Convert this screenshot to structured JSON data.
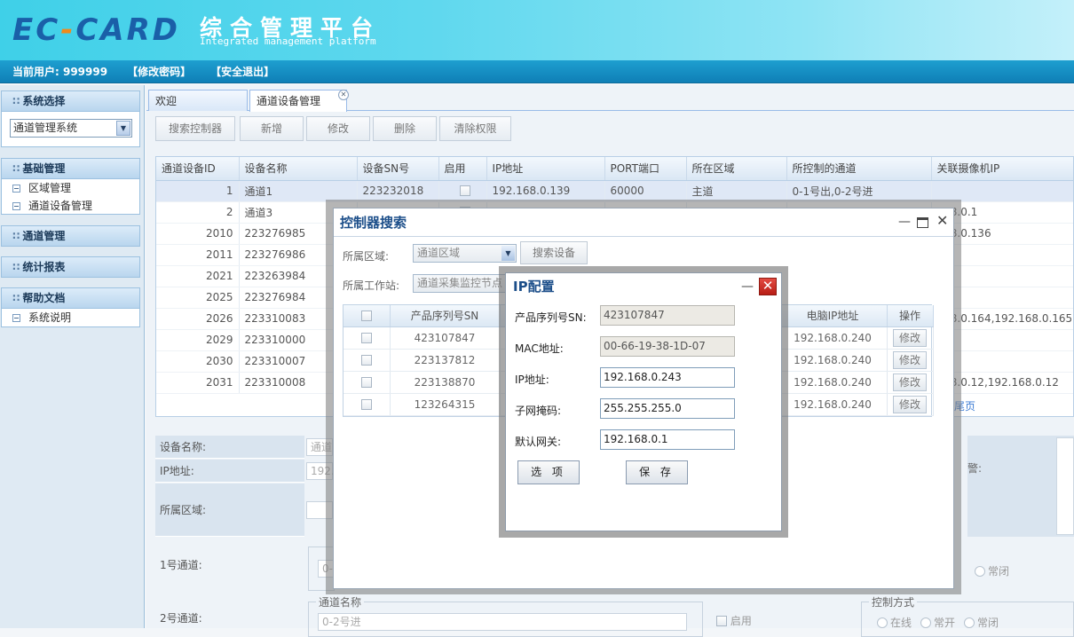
{
  "header": {
    "logo_left": "EC",
    "logo_dash": "-",
    "logo_right": "CARD",
    "title": "综合管理平台",
    "subtitle": "Integrated management platform"
  },
  "userbar": {
    "current_user": "当前用户: 999999",
    "change_pwd": "【修改密码】",
    "logout": "【安全退出】"
  },
  "sidebar": {
    "system_select": {
      "label": "系统选择",
      "value": "通道管理系统"
    },
    "basic": {
      "label": "基础管理",
      "items": [
        "区域管理",
        "通道设备管理"
      ]
    },
    "channel": {
      "label": "通道管理"
    },
    "stats": {
      "label": "统计报表"
    },
    "help": {
      "label": "帮助文档",
      "items": [
        "系统说明"
      ]
    }
  },
  "tabs": [
    "欢迎",
    "通道设备管理"
  ],
  "toolbar": {
    "search": "搜索控制器",
    "add": "新增",
    "edit": "修改",
    "delete": "删除",
    "clear": "清除权限"
  },
  "grid": {
    "columns": [
      "通道设备ID",
      "设备名称",
      "设备SN号",
      "启用",
      "IP地址",
      "PORT端口",
      "所在区域",
      "所控制的通道",
      "关联摄像机IP"
    ],
    "rows": [
      {
        "id": "1",
        "name": "通道1",
        "sn": "223232018",
        "ip": "192.168.0.139",
        "port": "60000",
        "area": "主道",
        "channels": "0-1号出,0-2号进",
        "cam": ""
      },
      {
        "id": "2",
        "name": "通道3",
        "sn": "",
        "ip": "",
        "port": "",
        "area": "",
        "channels": "",
        "cam": "168.0.1"
      },
      {
        "id": "2010",
        "name": "223276985",
        "sn": "",
        "ip": "",
        "port": "",
        "area": "",
        "channels": "",
        "cam": "168.0.136"
      },
      {
        "id": "2011",
        "name": "223276986",
        "sn": "",
        "ip": "",
        "port": "",
        "area": "",
        "channels": "",
        "cam": ""
      },
      {
        "id": "2021",
        "name": "223263984",
        "sn": "",
        "ip": "",
        "port": "",
        "area": "",
        "channels": "",
        "cam": ""
      },
      {
        "id": "2025",
        "name": "223276984",
        "sn": "",
        "ip": "",
        "port": "",
        "area": "",
        "channels": "",
        "cam": ""
      },
      {
        "id": "2026",
        "name": "223310083",
        "sn": "",
        "ip": "",
        "port": "",
        "area": "",
        "channels": "",
        "cam": "168.0.164,192.168.0.165"
      },
      {
        "id": "2029",
        "name": "223310000",
        "sn": "",
        "ip": "",
        "port": "",
        "area": "",
        "channels": "",
        "cam": ""
      },
      {
        "id": "2030",
        "name": "223310007",
        "sn": "",
        "ip": "",
        "port": "",
        "area": "",
        "channels": "",
        "cam": ""
      },
      {
        "id": "2031",
        "name": "223310008",
        "sn": "",
        "ip": "",
        "port": "",
        "area": "",
        "channels": "",
        "cam": "168.0.12,192.168.0.12"
      }
    ],
    "pager_tail": "尾页"
  },
  "form": {
    "device_name_label": "设备名称:",
    "device_name_value": "通道",
    "ip_label": "IP地址:",
    "ip_value": "192.",
    "area_label": "所属区域:",
    "ch1_label": "1号通道:",
    "ch1_value": "0-",
    "ch2_label": "2号通道:",
    "ch2_legend": "通道名称",
    "ch2_value": "0-2号进",
    "enable_label": "启用",
    "mode_legend": "控制方式",
    "mode_online": "在线",
    "mode_normal_open": "常开",
    "mode_normal_closed": "常闭",
    "right_label": "警:",
    "normal_closed_1": "常闭"
  },
  "win_search": {
    "title": "控制器搜索",
    "area_label": "所属区域:",
    "area_value": "通道区域",
    "search_btn": "搜索设备",
    "station_label": "所属工作站:",
    "station_value": "通道采集监控节点",
    "columns": [
      "产品序列号SN",
      "电脑IP地址",
      "操作"
    ],
    "rows": [
      {
        "sn": "423107847",
        "pc_ip": "192.168.0.240",
        "op": "修改"
      },
      {
        "sn": "223137812",
        "pc_ip": "192.168.0.240",
        "op": "修改"
      },
      {
        "sn": "223138870",
        "pc_ip": "192.168.0.240",
        "op": "修改"
      },
      {
        "sn": "123264315",
        "pc_ip": "192.168.0.240",
        "op": "修改"
      }
    ]
  },
  "win_ip": {
    "title": "IP配置",
    "sn_label": "产品序列号SN:",
    "sn_value": "423107847",
    "mac_label": "MAC地址:",
    "mac_value": "00-66-19-38-1D-07",
    "ip_label": "IP地址:",
    "ip_value": "192.168.0.243",
    "mask_label": "子网掩码:",
    "mask_value": "255.255.255.0",
    "gw_label": "默认网关:",
    "gw_value": "192.168.0.1",
    "options_btn": "选 项",
    "save_btn": "保 存"
  },
  "colors": {
    "header": "#3fd0e8",
    "userbar": "#1589c0",
    "accent": "#1d4f8a",
    "close": "#c8271e"
  }
}
